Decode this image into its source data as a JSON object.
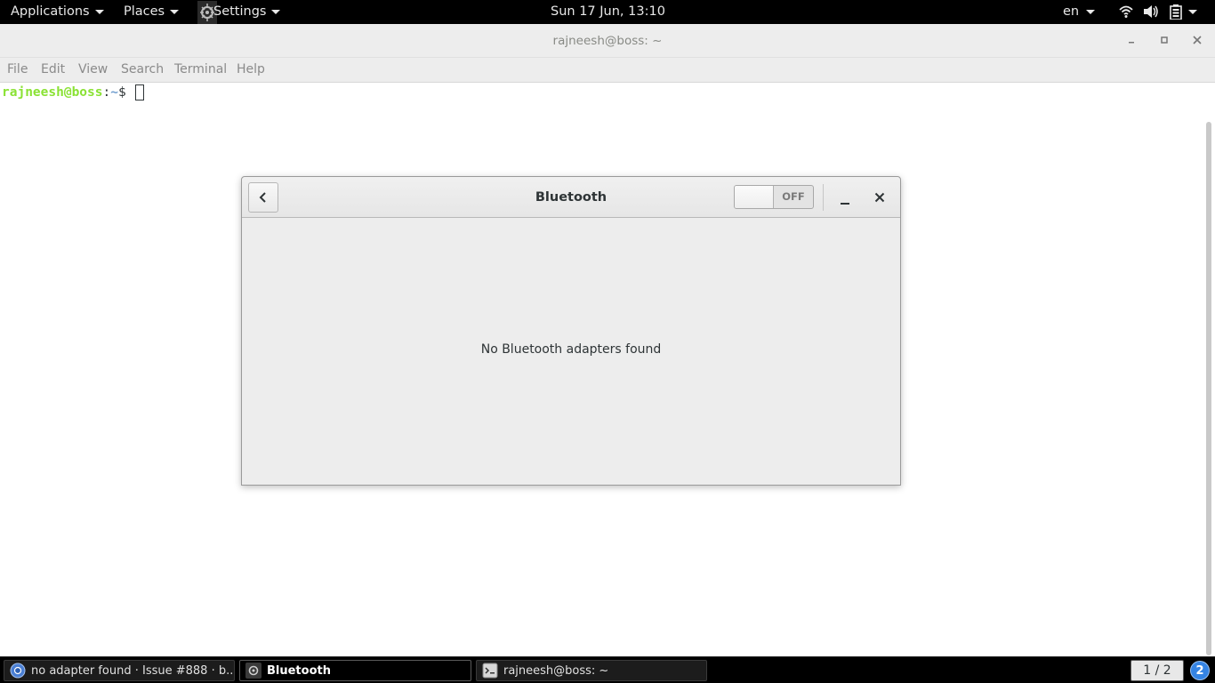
{
  "topbar": {
    "applications_label": "Applications",
    "places_label": "Places",
    "app_menu_label": "Settings",
    "clock": "Sun 17 Jun, 13:10",
    "input_language": "en",
    "tray_icons": [
      "wifi-icon",
      "volume-icon",
      "battery-icon",
      "system-menu-caret"
    ]
  },
  "terminal": {
    "title": "rajneesh@boss: ~",
    "menu": [
      "File",
      "Edit",
      "View",
      "Search",
      "Terminal",
      "Help"
    ],
    "prompt_user": "rajneesh@boss",
    "prompt_colon": ":",
    "prompt_path": "~",
    "prompt_symbol": "$ "
  },
  "bluetooth": {
    "title": "Bluetooth",
    "switch_state": "OFF",
    "message": "No Bluetooth adapters found"
  },
  "taskbar": {
    "tasks": [
      {
        "label": "no adapter found · Issue #888 · b...",
        "icon": "chromium-icon",
        "active": false
      },
      {
        "label": "Bluetooth",
        "icon": "settings-app-icon",
        "active": true
      },
      {
        "label": "rajneesh@boss: ~",
        "icon": "terminal-icon",
        "active": false
      }
    ],
    "workspace": "1 / 2",
    "notification_count": "2"
  },
  "colors": {
    "panel": "#000000",
    "prompt_user": "#8ae234",
    "prompt_path": "#729fcf",
    "notification": "#3584e4"
  }
}
